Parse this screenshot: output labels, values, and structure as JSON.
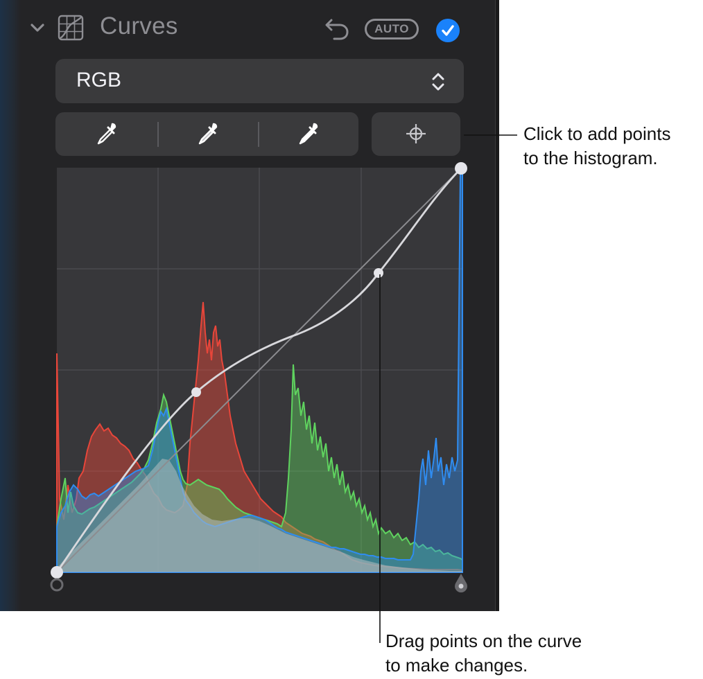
{
  "header": {
    "title": "Curves",
    "auto_label": "AUTO",
    "accent_color": "#1a82fb"
  },
  "channel_select": {
    "value": "RGB"
  },
  "eyedroppers": [
    "black-point-eyedropper-icon",
    "gray-point-eyedropper-icon",
    "white-point-eyedropper-icon"
  ],
  "annotations": {
    "add_points": {
      "line1": "Click to add points",
      "line2": "to the histogram."
    },
    "drag_points": {
      "line1": "Drag points on the curve",
      "line2": "to make changes."
    }
  },
  "histogram_colors": {
    "red": "#e8463a",
    "green": "#5fd35f",
    "blue": "#2f8cf0",
    "gray": "#8a9094"
  }
}
